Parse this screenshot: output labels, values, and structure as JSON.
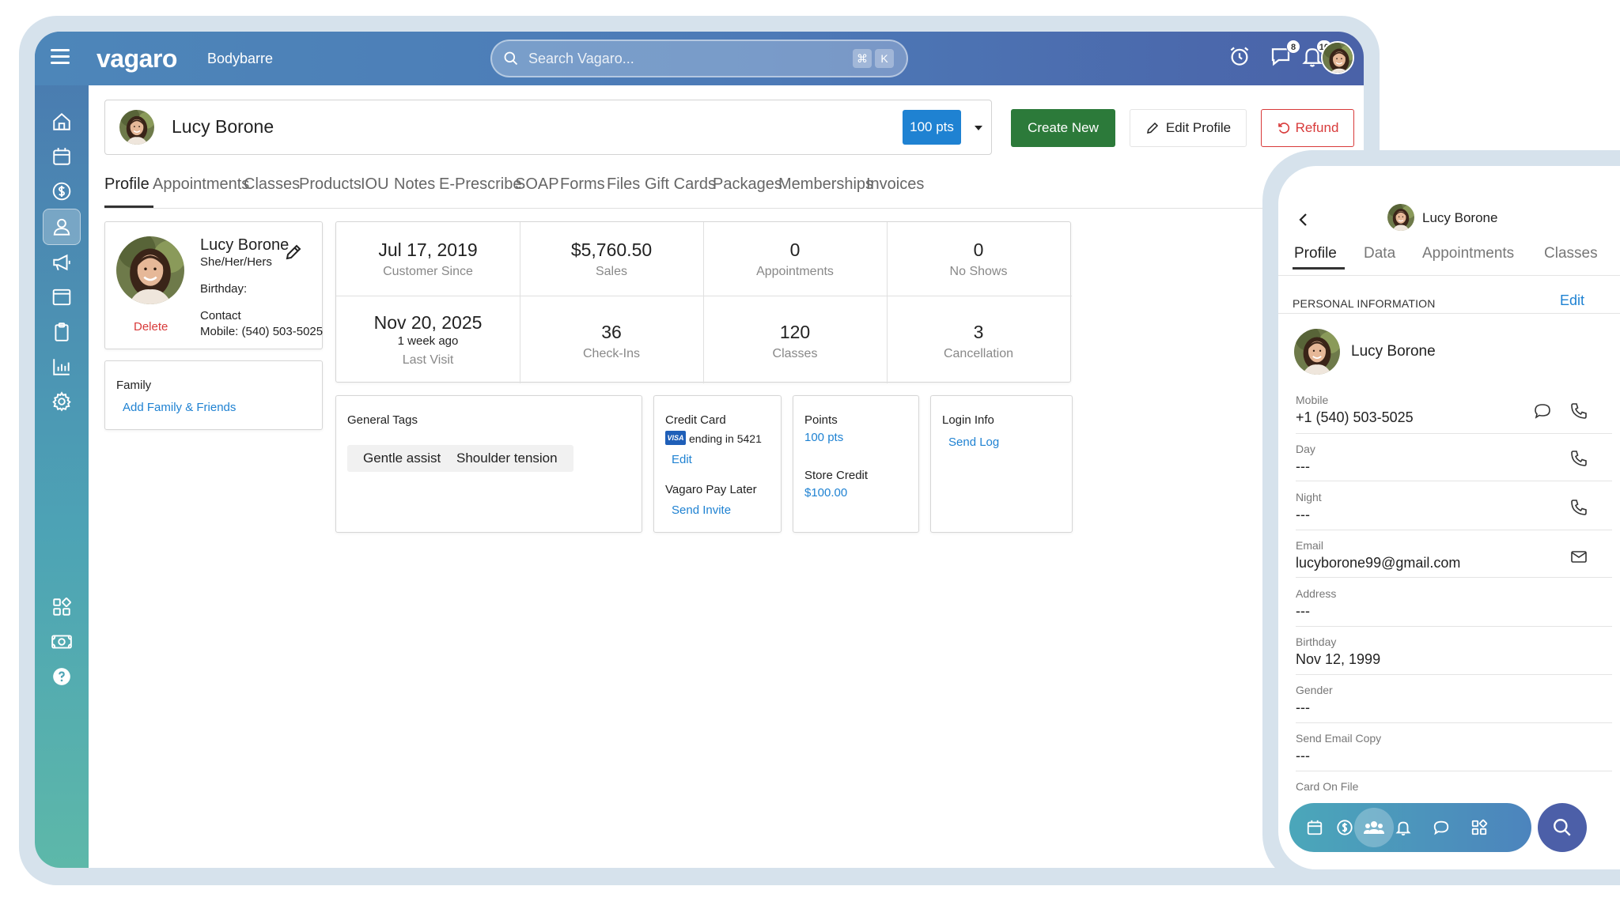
{
  "topbar": {
    "logo": "vagaro",
    "business": "Bodybarre",
    "search_placeholder": "Search Vagaro...",
    "kbd_cmd": "⌘",
    "kbd_k": "K",
    "messages_badge": "8",
    "notifications_badge": "10"
  },
  "client": {
    "name": "Lucy Borone",
    "points": "100 pts"
  },
  "actions": {
    "create_new": "Create New",
    "edit_profile": "Edit Profile",
    "refund": "Refund"
  },
  "tabs": [
    "Profile",
    "Appointments",
    "Classes",
    "Products",
    "IOU",
    "Notes",
    "E-Prescribe",
    "SOAP",
    "Forms",
    "Files",
    "Gift Cards",
    "Packages",
    "Memberships",
    "Invoices"
  ],
  "profile_card": {
    "name": "Lucy Borone",
    "pronouns": "She/Her/Hers",
    "birthday_label": "Birthday:",
    "contact_label": "Contact",
    "mobile": "Mobile: (540) 503-5025",
    "delete": "Delete"
  },
  "family": {
    "title": "Family",
    "add_link": "Add Family & Friends"
  },
  "stats": {
    "customer_since_value": "Jul 17, 2019",
    "customer_since_label": "Customer Since",
    "sales_value": "$5,760.50",
    "sales_label": "Sales",
    "appointments_value": "0",
    "appointments_label": "Appointments",
    "no_shows_value": "0",
    "no_shows_label": "No Shows",
    "last_visit_value": "Nov 20, 2025",
    "last_visit_rel": "1 week ago",
    "last_visit_label": "Last Visit",
    "checkins_value": "36",
    "checkins_label": "Check-Ins",
    "classes_value": "120",
    "classes_label": "Classes",
    "cancellations_value": "3",
    "cancellations_label": "Cancellation"
  },
  "tags": {
    "title": "General Tags",
    "items": [
      "Gentle assists",
      "Shoulder tension"
    ]
  },
  "credit_card": {
    "title": "Credit Card",
    "brand": "VISA",
    "ending": "ending in 5421",
    "edit": "Edit",
    "pay_later_title": "Vagaro Pay Later",
    "send_invite": "Send Invite"
  },
  "points": {
    "title": "Points",
    "value": "100 pts",
    "store_credit_title": "Store Credit",
    "store_credit_value": "$100.00"
  },
  "login": {
    "title": "Login Info",
    "send_link": "Send Log"
  },
  "mobile": {
    "title": "Lucy Borone",
    "tabs": [
      "Profile",
      "Data",
      "Appointments",
      "Classes"
    ],
    "section": "PERSONAL INFORMATION",
    "edit": "Edit",
    "name": "Lucy Borone",
    "fields": [
      {
        "label": "Mobile",
        "value": "+1 (540) 503-5025"
      },
      {
        "label": "Day",
        "value": "---"
      },
      {
        "label": "Night",
        "value": "---"
      },
      {
        "label": "Email",
        "value": "lucyborone99@gmail.com"
      },
      {
        "label": "Address",
        "value": "---"
      },
      {
        "label": "Birthday",
        "value": "Nov 12, 1999"
      },
      {
        "label": "Gender",
        "value": "---"
      },
      {
        "label": "Send Email Copy",
        "value": "---"
      },
      {
        "label": "Card On File",
        "value": ""
      }
    ]
  },
  "colors": {
    "primary_blue": "#1f82d2",
    "create_green": "#2c7a3a",
    "refund_red": "#d83a3a",
    "topbar_start": "#4d86b9",
    "topbar_end": "#4a62a8"
  },
  "icons": [
    "menu-icon",
    "search-icon",
    "alarm-clock-icon",
    "chat-icon",
    "bell-icon",
    "home-icon",
    "calendar-icon",
    "dollar-icon",
    "person-icon",
    "megaphone-icon",
    "browser-window-icon",
    "clipboard-icon",
    "bar-chart-icon",
    "gear-icon",
    "apps-grid-icon",
    "cash-icon",
    "help-icon",
    "pencil-icon",
    "refund-arrow-icon",
    "caret-down-icon",
    "visa-icon",
    "chevron-left-icon",
    "phone-icon",
    "message-icon",
    "mail-icon",
    "people-icon"
  ]
}
